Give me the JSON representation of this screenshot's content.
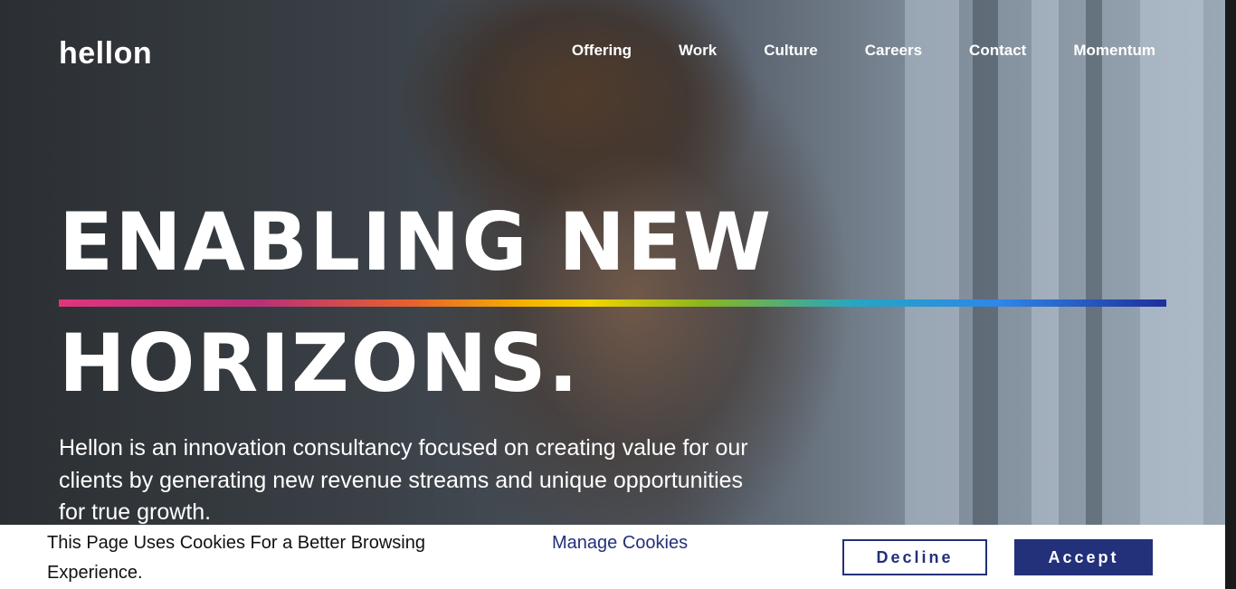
{
  "brand": {
    "logo_text": "hellon"
  },
  "nav": {
    "items": [
      {
        "label": "Offering"
      },
      {
        "label": "Work"
      },
      {
        "label": "Culture"
      },
      {
        "label": "Careers"
      },
      {
        "label": "Contact"
      },
      {
        "label": "Momentum"
      }
    ]
  },
  "hero": {
    "headline_line1": "ENABLING NEW",
    "headline_line2": "HORIZONS.",
    "lead": "Hellon is an innovation consultancy focused on creating value for our clients by generating new revenue streams and unique opportunities for true growth."
  },
  "cookie_banner": {
    "message": "This Page Uses Cookies For a Better Browsing Experience.",
    "manage_label": "Manage Cookies",
    "decline_label": "Decline",
    "accept_label": "Accept"
  },
  "colors": {
    "accent": "#23307a",
    "text_on_hero": "#ffffff"
  }
}
